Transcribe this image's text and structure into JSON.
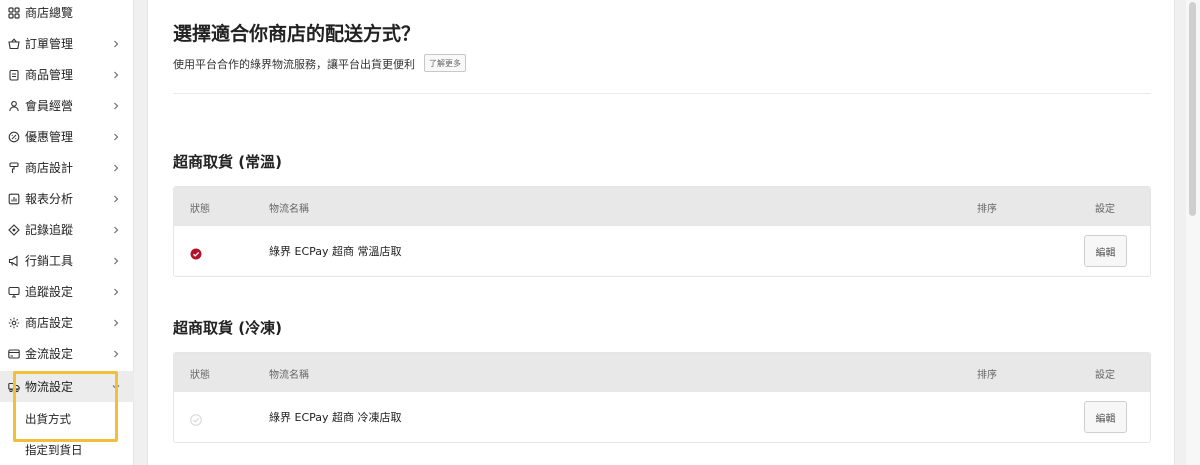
{
  "sidebar": {
    "items": [
      {
        "label": "商店總覽",
        "icon": "dashboard-icon",
        "chevron": false
      },
      {
        "label": "訂單管理",
        "icon": "basket-icon",
        "chevron": true
      },
      {
        "label": "商品管理",
        "icon": "clipboard-icon",
        "chevron": true
      },
      {
        "label": "會員經營",
        "icon": "user-icon",
        "chevron": true
      },
      {
        "label": "優惠管理",
        "icon": "discount-icon",
        "chevron": true
      },
      {
        "label": "商店設計",
        "icon": "paint-roller-icon",
        "chevron": true
      },
      {
        "label": "報表分析",
        "icon": "chart-icon",
        "chevron": true
      },
      {
        "label": "記錄追蹤",
        "icon": "target-icon",
        "chevron": true
      },
      {
        "label": "行銷工具",
        "icon": "megaphone-icon",
        "chevron": true
      },
      {
        "label": "追蹤設定",
        "icon": "monitor-icon",
        "chevron": true
      },
      {
        "label": "商店設定",
        "icon": "gear-icon",
        "chevron": true
      },
      {
        "label": "金流設定",
        "icon": "credit-card-icon",
        "chevron": true
      },
      {
        "label": "物流設定",
        "icon": "truck-icon",
        "chevron": "down"
      }
    ],
    "subitems": [
      {
        "label": "出貨方式"
      },
      {
        "label": "指定到貨日"
      }
    ]
  },
  "main": {
    "title": "選擇適合你商店的配送方式？",
    "subtitle": "使用平台合作的綠界物流服務，讓平台出貨更便利",
    "learn_more": "了解更多",
    "sections": [
      {
        "title": "超商取貨 (常溫)",
        "headers": {
          "status": "狀態",
          "name": "物流名稱",
          "order": "排序",
          "settings": "設定"
        },
        "rows": [
          {
            "name": "綠界 ECPay 超商 常溫店取",
            "enabled": true,
            "edit": "編輯"
          }
        ]
      },
      {
        "title": "超商取貨 (冷凍)",
        "headers": {
          "status": "狀態",
          "name": "物流名稱",
          "order": "排序",
          "settings": "設定"
        },
        "rows": [
          {
            "name": "綠界 ECPay 超商 冷凍店取",
            "enabled": false,
            "edit": "編輯"
          }
        ]
      }
    ]
  },
  "colors": {
    "highlight": "#f2bf3a",
    "enabled_status": "#b3122a",
    "disabled_status": "#d6d6d6"
  }
}
